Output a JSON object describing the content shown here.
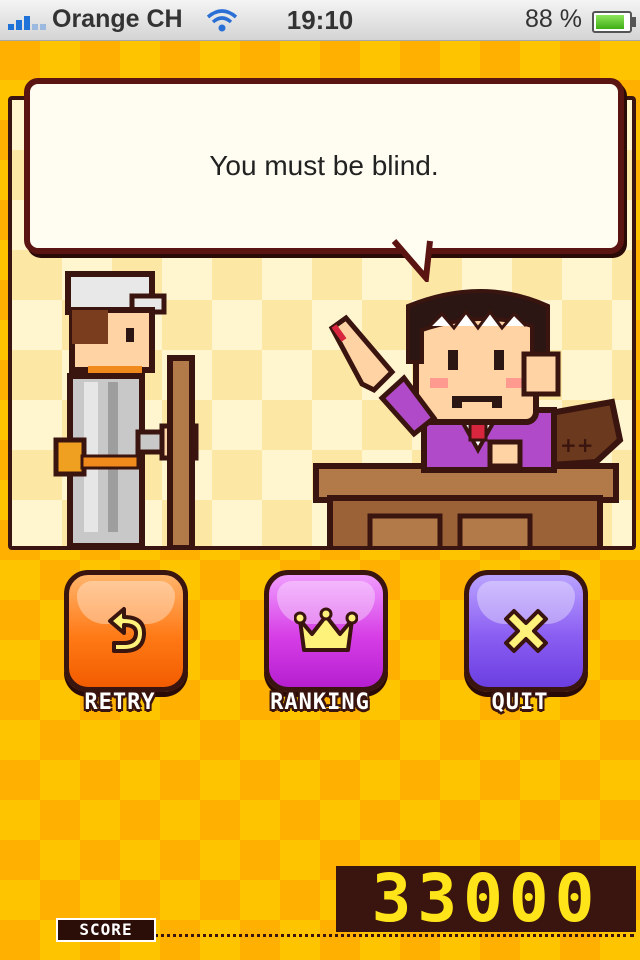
{
  "status_bar": {
    "carrier": "Orange CH",
    "time": "19:10",
    "battery": "88 %",
    "battery_level": 0.88,
    "icons": [
      "signal-icon",
      "wifi-icon",
      "battery-icon"
    ]
  },
  "dialog": {
    "text": "You must be blind."
  },
  "buttons": {
    "retry": {
      "label": "RETRY",
      "icon": "retry-arrow-icon"
    },
    "ranking": {
      "label": "RANKING",
      "icon": "crown-icon"
    },
    "quit": {
      "label": "QUIT",
      "icon": "close-x-icon"
    }
  },
  "score": {
    "label": "SCORE",
    "value": "33000"
  },
  "colors": {
    "background": "#ffc400",
    "retry": "#ff7a16",
    "ranking": "#d63ee6",
    "quit": "#8a5df2",
    "score_digits": "#ffe41a",
    "outline": "#3a140e"
  }
}
